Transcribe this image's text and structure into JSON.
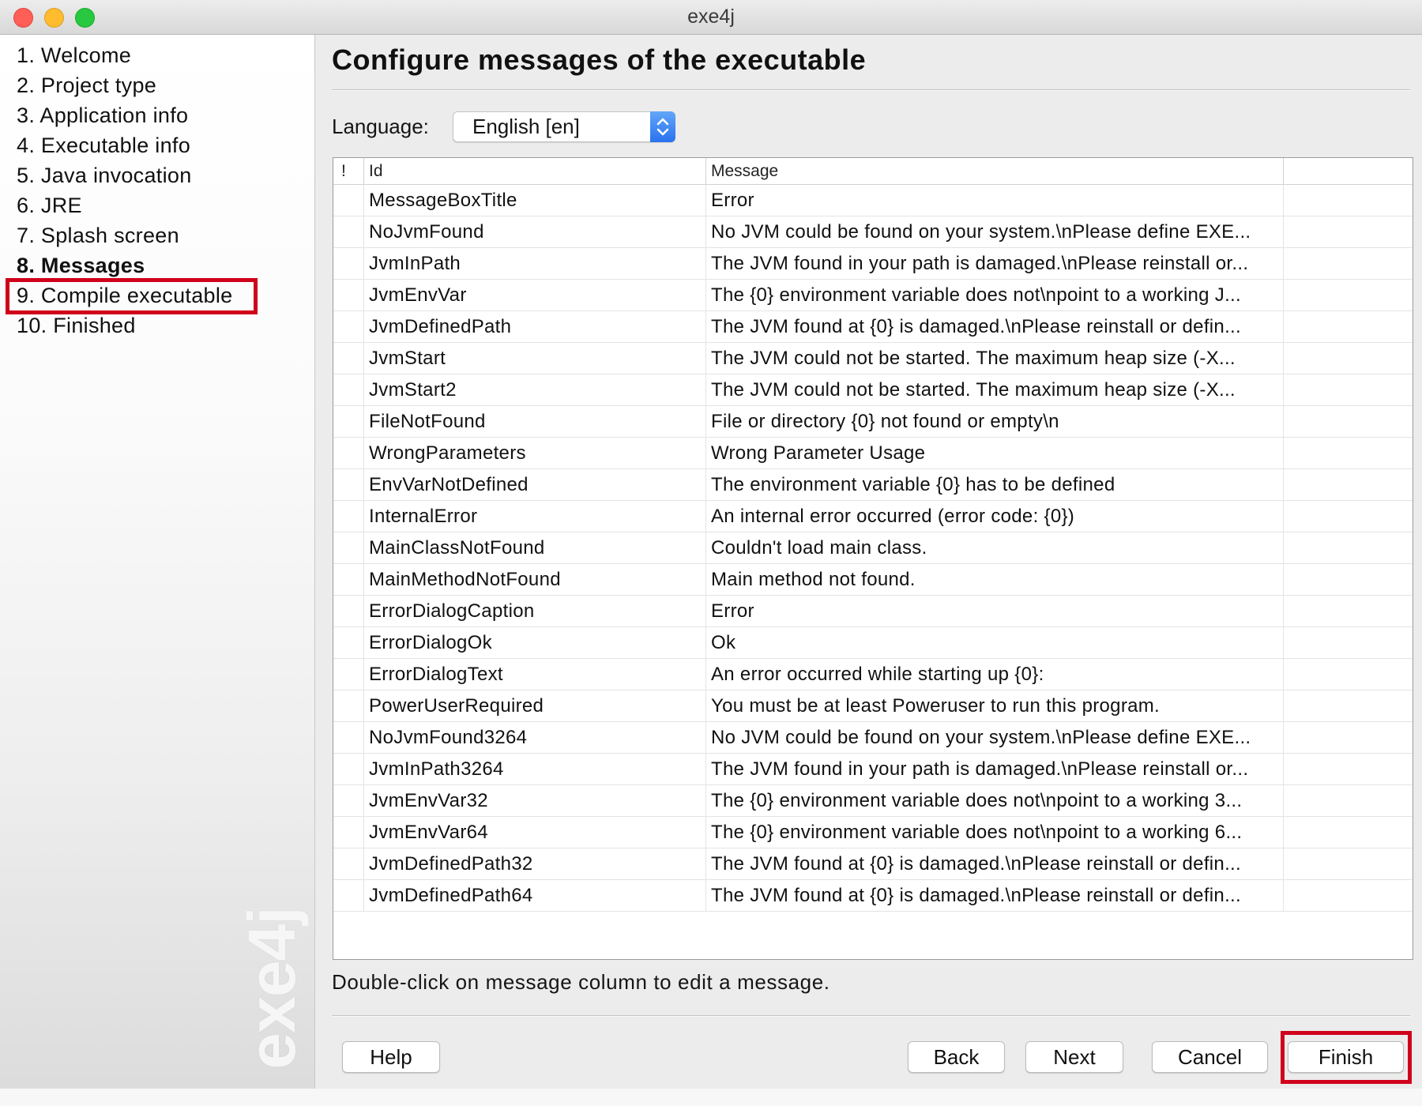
{
  "window": {
    "title": "exe4j",
    "controls": [
      {
        "name": "close",
        "color": "#ff5f57"
      },
      {
        "name": "minimize",
        "color": "#febc2e"
      },
      {
        "name": "zoom",
        "color": "#28c840"
      }
    ]
  },
  "sidebar": {
    "items": [
      {
        "label": "1. Welcome"
      },
      {
        "label": "2. Project type"
      },
      {
        "label": "3. Application info"
      },
      {
        "label": "4. Executable info"
      },
      {
        "label": "5. Java invocation"
      },
      {
        "label": "6. JRE"
      },
      {
        "label": "7. Splash screen"
      },
      {
        "label": "8. Messages",
        "active": true
      },
      {
        "label": "9. Compile executable",
        "highlighted": true
      },
      {
        "label": "10. Finished"
      }
    ],
    "watermark": "exe4j"
  },
  "main": {
    "heading": "Configure messages of the executable",
    "language": {
      "label": "Language:",
      "selected": "English [en]"
    },
    "table": {
      "columns": [
        "!",
        "Id",
        "Message"
      ],
      "rows": [
        {
          "id": "MessageBoxTitle",
          "message": "Error"
        },
        {
          "id": "NoJvmFound",
          "message": "No JVM could be found on your system.\\nPlease define EXE..."
        },
        {
          "id": "JvmInPath",
          "message": "The JVM found in your path is damaged.\\nPlease reinstall or..."
        },
        {
          "id": "JvmEnvVar",
          "message": "The {0} environment variable does not\\npoint to a working J..."
        },
        {
          "id": "JvmDefinedPath",
          "message": "The JVM found at {0} is damaged.\\nPlease reinstall or defin..."
        },
        {
          "id": "JvmStart",
          "message": "The JVM could not be started. The maximum heap size (-X..."
        },
        {
          "id": "JvmStart2",
          "message": "The JVM could not be started. The maximum heap size (-X..."
        },
        {
          "id": "FileNotFound",
          "message": "File or directory {0} not found or empty\\n"
        },
        {
          "id": "WrongParameters",
          "message": "Wrong Parameter Usage"
        },
        {
          "id": "EnvVarNotDefined",
          "message": "The environment variable {0} has to be defined"
        },
        {
          "id": "InternalError",
          "message": "An internal error occurred (error code: {0})"
        },
        {
          "id": "MainClassNotFound",
          "message": "Couldn't load main class."
        },
        {
          "id": "MainMethodNotFound",
          "message": "Main method not found."
        },
        {
          "id": "ErrorDialogCaption",
          "message": "Error"
        },
        {
          "id": "ErrorDialogOk",
          "message": "Ok"
        },
        {
          "id": "ErrorDialogText",
          "message": "An error occurred while starting up {0}:"
        },
        {
          "id": "PowerUserRequired",
          "message": "You must be at least Poweruser to run this program."
        },
        {
          "id": "NoJvmFound3264",
          "message": "No JVM could be found on your system.\\nPlease define EXE..."
        },
        {
          "id": "JvmInPath3264",
          "message": "The JVM found in your path is damaged.\\nPlease reinstall or..."
        },
        {
          "id": "JvmEnvVar32",
          "message": "The {0} environment variable does not\\npoint to a working 3..."
        },
        {
          "id": "JvmEnvVar64",
          "message": "The {0} environment variable does not\\npoint to a working 6..."
        },
        {
          "id": "JvmDefinedPath32",
          "message": "The JVM found at {0} is damaged.\\nPlease reinstall or defin..."
        },
        {
          "id": "JvmDefinedPath64",
          "message": "The JVM found at {0} is damaged.\\nPlease reinstall or defin..."
        }
      ]
    },
    "hint": "Double-click on message column to edit a message."
  },
  "buttons": {
    "help": "Help",
    "back": "Back",
    "next": "Next",
    "cancel": "Cancel",
    "finish": {
      "label": "Finish",
      "highlighted": true
    }
  },
  "icons": {
    "language_stepper": "chevron-up-down-icon",
    "window_controls": [
      "close-window-icon",
      "minimize-window-icon",
      "zoom-window-icon"
    ]
  },
  "colors": {
    "highlight_red": "#d0021b",
    "accent_blue": "#2a72ee",
    "window_bg": "#ececec"
  }
}
